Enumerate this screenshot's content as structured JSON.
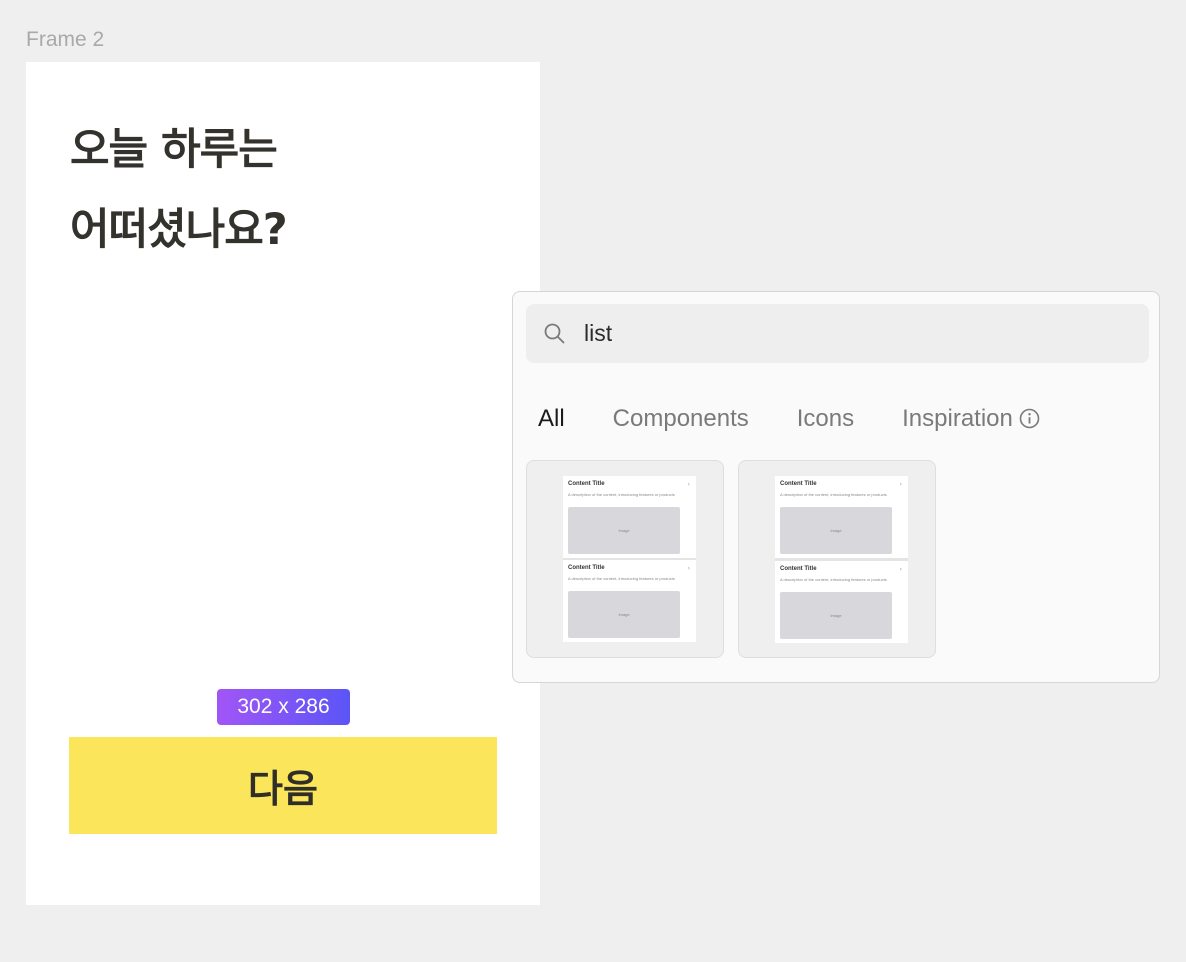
{
  "frame": {
    "label": "Frame 2"
  },
  "screen": {
    "title_line1": "오늘 하루는",
    "title_line2": "어떠셨나요?",
    "size_badge": "302 x 286",
    "next_button": "다음"
  },
  "panel": {
    "search": {
      "value": "list",
      "icon": "search-icon"
    },
    "tabs": [
      {
        "label": "All",
        "active": true
      },
      {
        "label": "Components",
        "active": false
      },
      {
        "label": "Icons",
        "active": false
      },
      {
        "label": "Inspiration",
        "active": false,
        "icon": "info-icon"
      }
    ],
    "results": [
      {
        "items": [
          {
            "title": "Content Title",
            "desc": "A description of the content, introducing features or products",
            "image": "Image"
          },
          {
            "title": "Content Title",
            "desc": "A description of the content, introducing features or products",
            "image": "Image"
          }
        ]
      },
      {
        "items": [
          {
            "title": "Content Title",
            "desc": "A description of the content, introducing features or products",
            "image": "Image"
          },
          {
            "title": "Content Title",
            "desc": "A description of the content, introducing features or products",
            "image": "Image"
          }
        ]
      }
    ]
  },
  "colors": {
    "button_bg": "#fbe55a",
    "badge_gradient_start": "#a255f6",
    "badge_gradient_end": "#5b55f6"
  }
}
